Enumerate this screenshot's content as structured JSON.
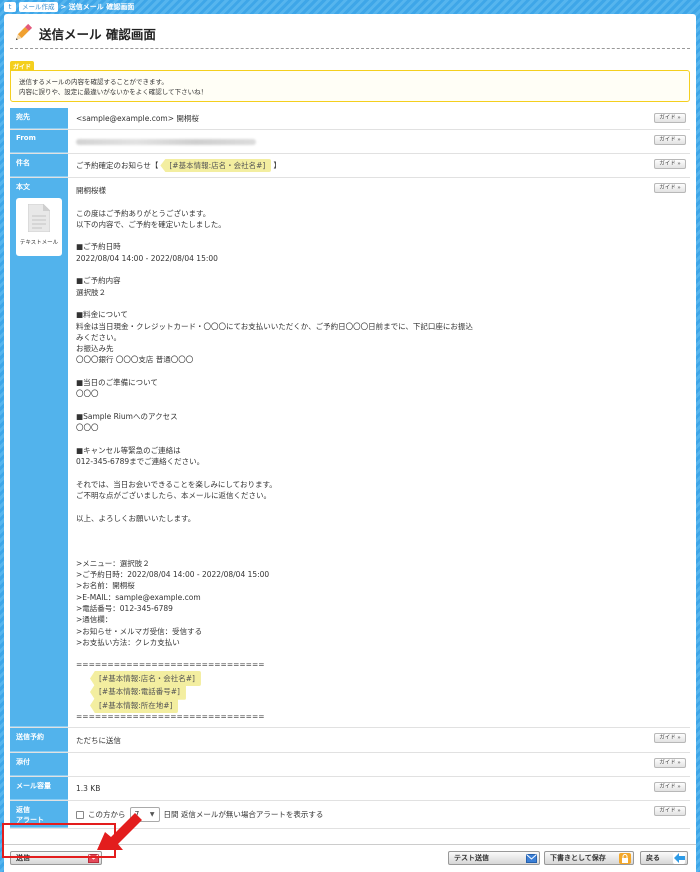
{
  "breadcrumb": {
    "home_glyph": "t",
    "parent": "メール作成",
    "current": "> 送信メール 確認画面"
  },
  "page": {
    "title": "送信メール 確認画面"
  },
  "guide": {
    "tag": "ガイド",
    "lines": [
      "送信するメールの内容を確認することができます。",
      "内容に誤りや、設定に最違いがないかをよく確認して下さいね！"
    ]
  },
  "guide_button_label": "ガイド »",
  "form": {
    "to": {
      "label": "宛先",
      "value": "<sample@example.com> 開桐桜"
    },
    "from": {
      "label": "From"
    },
    "subject": {
      "label": "件名",
      "prefix": "ご予約確定のお知らせ【",
      "tag": "[#基本情報:店名・会社名#]",
      "suffix": "】"
    },
    "body": {
      "label": "本文",
      "doc_label": "テキストメール",
      "lines": [
        "開桐桜様",
        "",
        "この度はご予約ありがとうございます。",
        "以下の内容で、ご予約を確定いたしました。",
        "",
        "■ご予約日時",
        "2022/08/04 14:00 - 2022/08/04 15:00",
        "",
        "■ご予約内容",
        "選択肢２",
        "",
        "■料金について",
        "料金は当日現金・クレジットカード・〇〇〇にてお支払いいただくか、ご予約日〇〇〇日前までに、下記口座にお振込",
        "みください。",
        "お振込み先",
        "〇〇〇銀行 〇〇〇支店 普通〇〇〇",
        "",
        "■当日のご準備について",
        "〇〇〇",
        "",
        "■Sample Riumへのアクセス",
        "〇〇〇",
        "",
        "■キャンセル等緊急のご連絡は",
        "012-345-6789までご連絡ください。",
        "",
        "それでは、当日お会いできることを楽しみにしております。",
        "ご不明な点がございましたら、本メールに返信ください。",
        "",
        "以上、よろしくお願いいたします。",
        "",
        "",
        "",
        ">メニュー：選択肢２",
        ">ご予約日時：2022/08/04 14:00 - 2022/08/04 15:00",
        ">お名前：開桐桜",
        ">E-MAIL：sample@example.com",
        ">電話番号：012-345-6789",
        ">通信欄：",
        ">お知らせ・メルマガ受信：受信する",
        ">お支払い方法：クレカ支払い",
        "",
        "=============================="
      ],
      "tags": [
        "[#基本情報:店名・会社名#]",
        "[#基本情報:電話番号#]",
        "[#基本情報:所在地#]"
      ],
      "closing": "=============================="
    },
    "schedule": {
      "label": "送信予約",
      "value": "ただちに送信"
    },
    "attachment": {
      "label": "添付"
    },
    "size": {
      "label": "メール容量",
      "value": "1.3 KB"
    },
    "alert": {
      "label_line1": "返信",
      "label_line2": "アラート",
      "prefix": "この方から",
      "days": "7",
      "suffix": "日間 返信メールが無い場合アラートを表示する"
    }
  },
  "footer": {
    "send": "送信",
    "test_send": "テスト送信",
    "save_draft": "下書きとして保存",
    "back": "戻る"
  },
  "colors": {
    "accent": "#52b3ec",
    "guide_yellow": "#f4cf1e",
    "highlight_red": "#e31d1d"
  }
}
